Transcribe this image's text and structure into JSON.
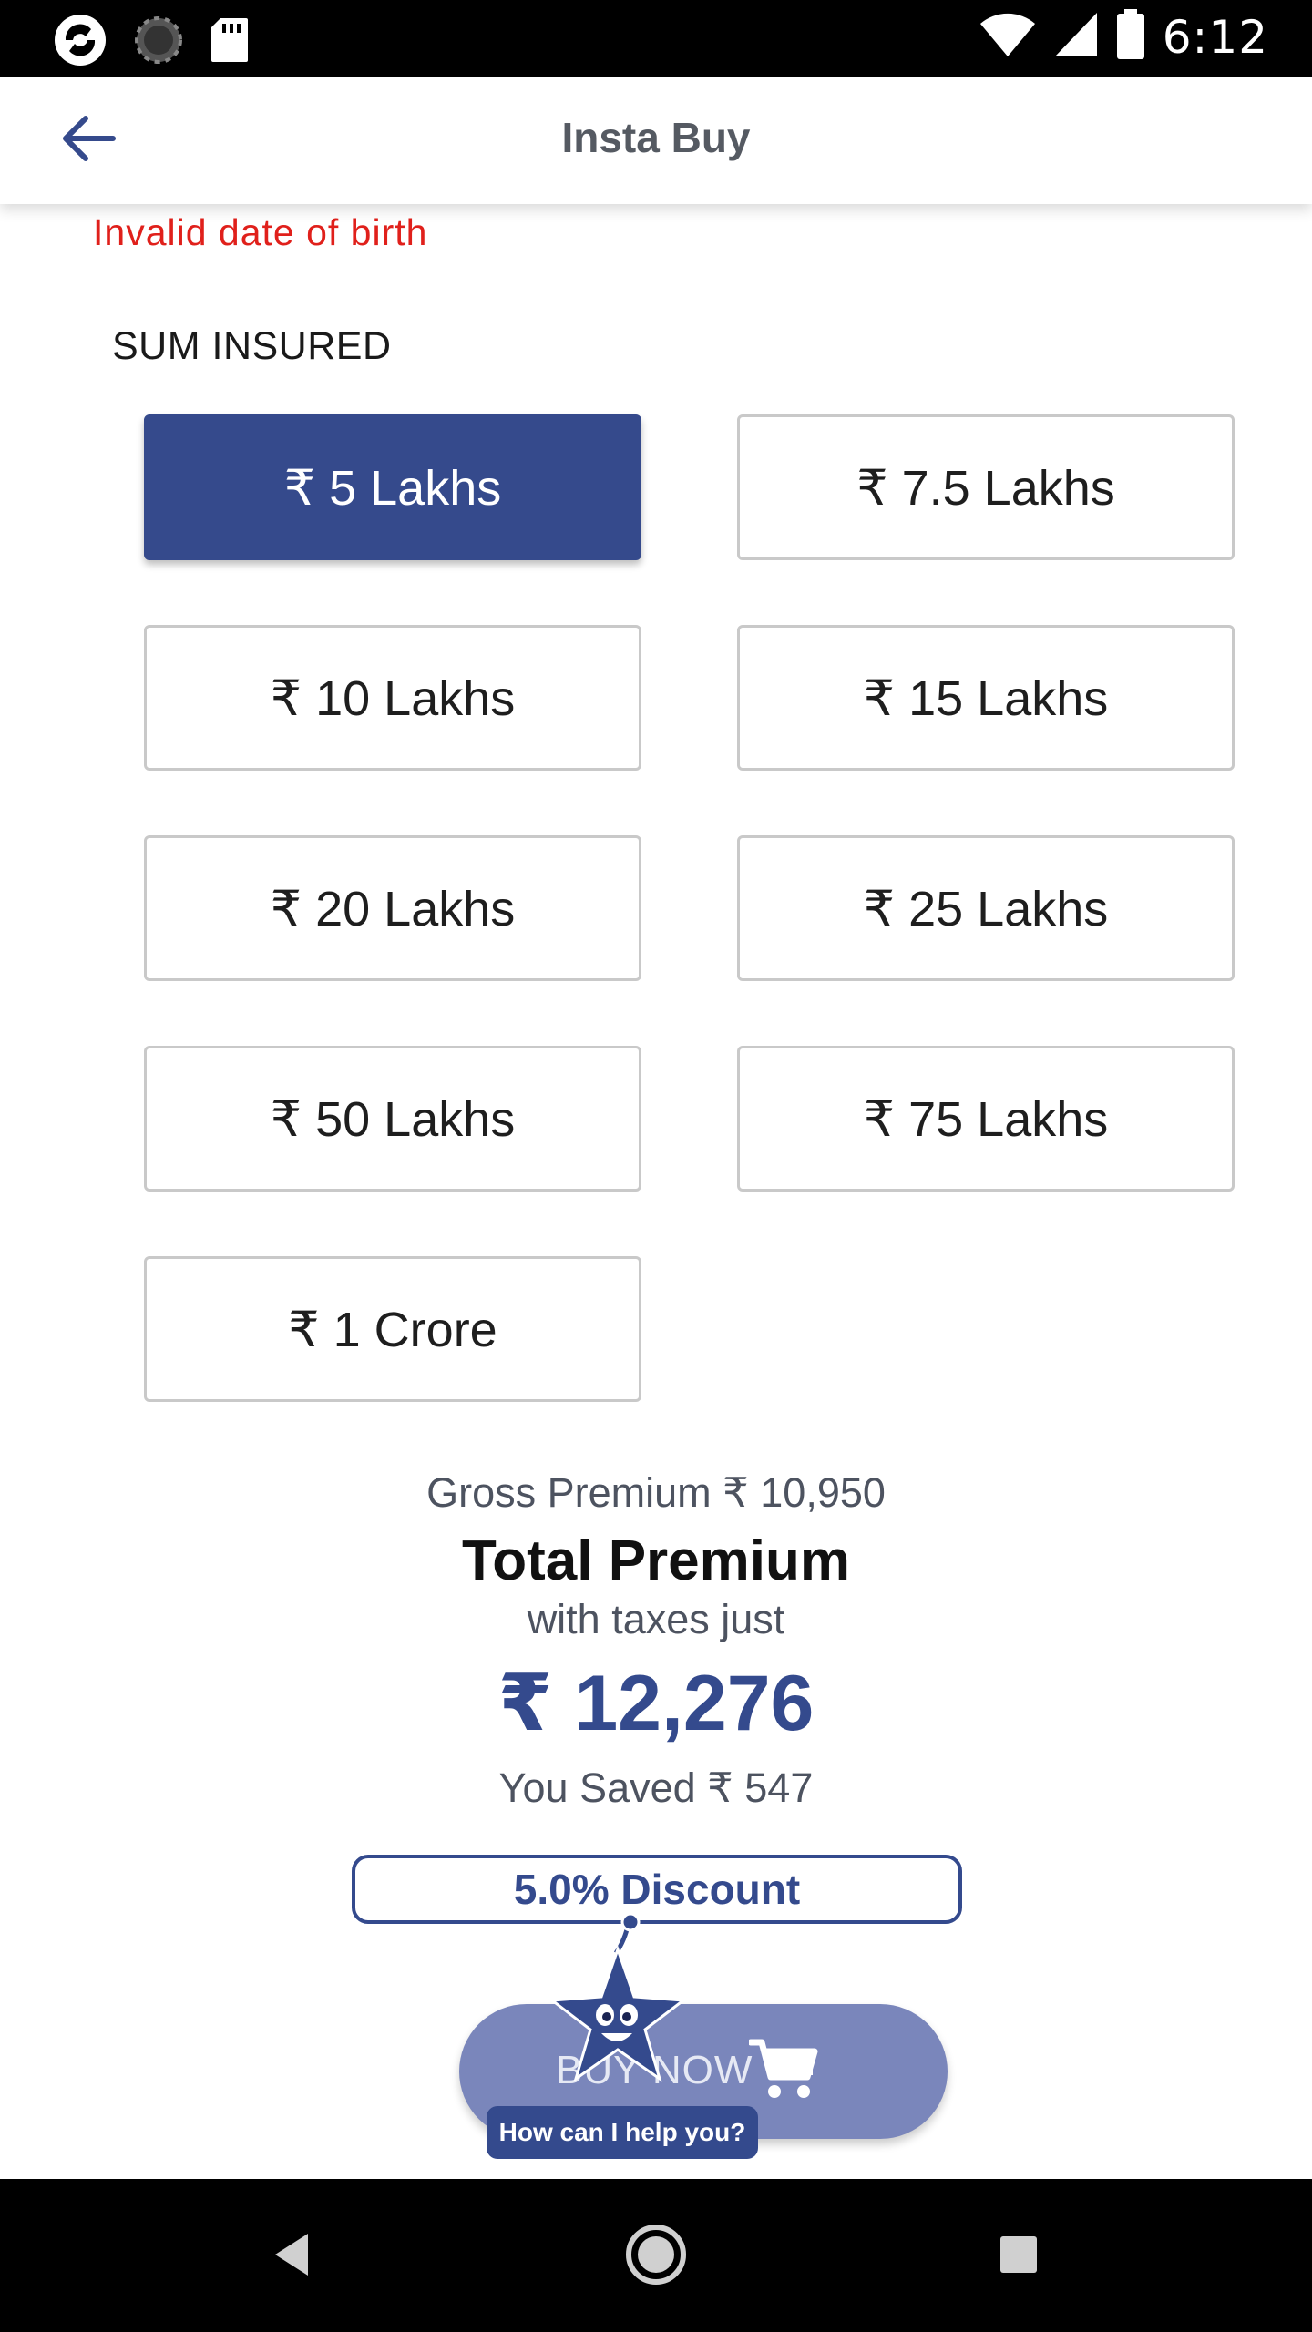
{
  "status_bar": {
    "time": "6:12",
    "left_icons": [
      "app-logo-icon",
      "loading-icon",
      "sd-card-icon"
    ],
    "right_icons": [
      "wifi-icon",
      "signal-icon",
      "battery-icon"
    ]
  },
  "app_bar": {
    "title": "Insta Buy",
    "back_icon": "arrow-left-icon"
  },
  "error": {
    "message": "Invalid date of birth"
  },
  "sum_insured": {
    "label": "SUM INSURED",
    "options": [
      {
        "label": "₹ 5 Lakhs",
        "selected": true
      },
      {
        "label": "₹ 7.5 Lakhs",
        "selected": false
      },
      {
        "label": "₹ 10 Lakhs",
        "selected": false
      },
      {
        "label": "₹ 15 Lakhs",
        "selected": false
      },
      {
        "label": "₹ 20 Lakhs",
        "selected": false
      },
      {
        "label": "₹ 25 Lakhs",
        "selected": false
      },
      {
        "label": "₹ 50 Lakhs",
        "selected": false
      },
      {
        "label": "₹ 75 Lakhs",
        "selected": false
      },
      {
        "label": "₹ 1 Crore",
        "selected": false
      }
    ]
  },
  "premium": {
    "gross": "Gross Premium ₹ 10,950",
    "total_title": "Total Premium",
    "with_taxes": "with taxes just",
    "total_amount": "₹ 12,276",
    "saved": "You Saved ₹ 547",
    "discount": "5.0% Discount"
  },
  "buy": {
    "label": "BUY NOW",
    "icon": "shopping-cart-icon"
  },
  "assistant": {
    "bubble": "How can I help you?",
    "icon": "star-mascot-icon"
  },
  "nav_bar": {
    "icons": [
      "back-triangle-icon",
      "home-circle-icon",
      "recents-square-icon"
    ]
  },
  "colors": {
    "primary": "#354a8c",
    "buy_button": "#7a86bb",
    "error": "#e0201b"
  }
}
